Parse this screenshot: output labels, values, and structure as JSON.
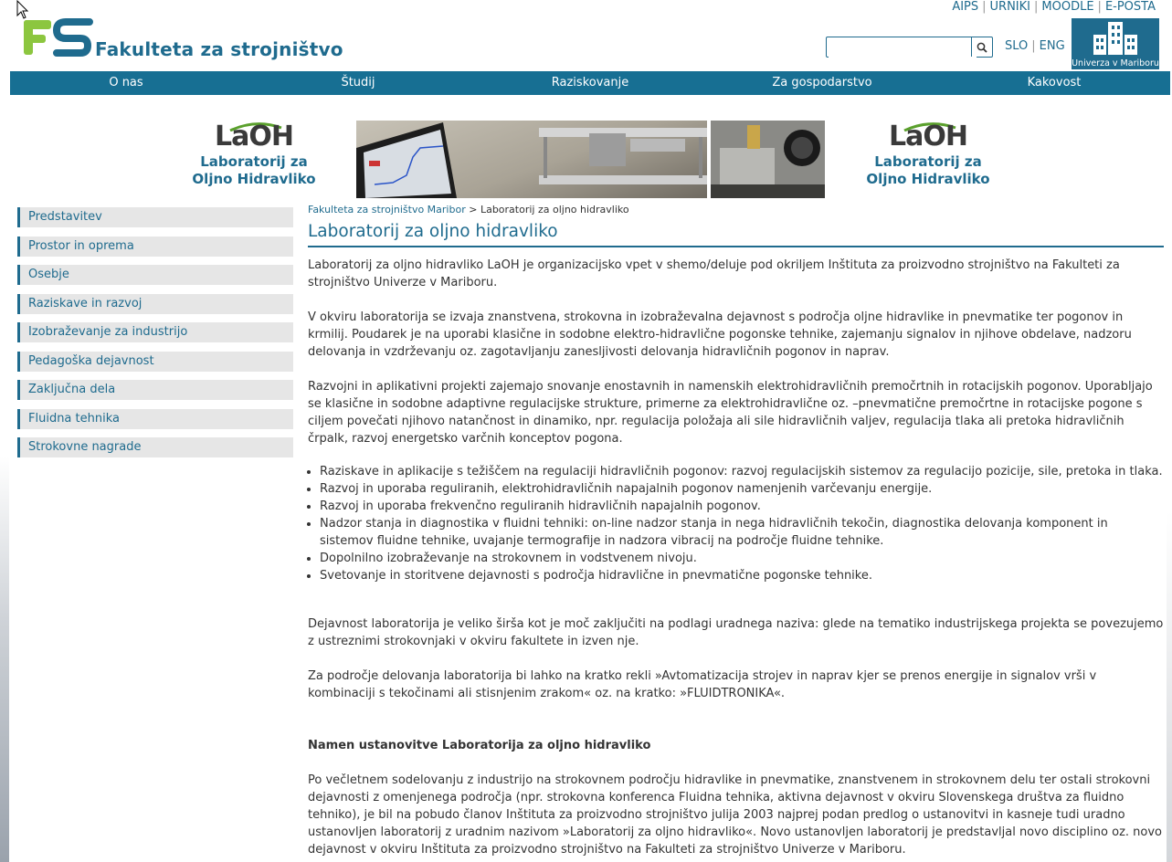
{
  "top_links": [
    "AIPS",
    "URNIKI",
    "MOODLE",
    "E-POŠTA"
  ],
  "logo": {
    "mark": "FS",
    "faculty": "Fakulteta za strojništvo"
  },
  "search": {
    "value": "",
    "placeholder": ""
  },
  "lang": [
    "SLO",
    "ENG"
  ],
  "university": {
    "caption": "Univerza v Mariboru"
  },
  "nav": [
    "O nas",
    "Študij",
    "Raziskovanje",
    "Za gospodarstvo",
    "Kakovost"
  ],
  "banner": {
    "lab_mark": "LaOH",
    "lab_line1": "Laboratorij za",
    "lab_line2": "Oljno Hidravliko"
  },
  "sidebar": [
    "Predstavitev",
    "Prostor in oprema",
    "Osebje",
    "Raziskave in razvoj",
    "Izobraževanje za industrijo",
    "Pedagoška dejavnost",
    "Zaključna dela",
    "Fluidna tehnika",
    "Strokovne nagrade"
  ],
  "breadcrumb": {
    "home": "Fakulteta za strojništvo Maribor",
    "separator": " > ",
    "current": "Laboratorij za oljno hidravliko"
  },
  "page_title": "Laboratorij za oljno hidravliko",
  "paragraphs": [
    "Laboratorij za oljno hidravliko LaOH je organizacijsko vpet v shemo/deluje pod okriljem Inštituta za proizvodno strojništvo na Fakulteti za strojništvo Univerze v Mariboru.",
    "V okviru laboratorija se izvaja znanstvena, strokovna in izobraževalna dejavnost s področja oljne hidravlike in pnevmatike ter pogonov in krmilij. Poudarek je na uporabi klasične in sodobne elektro-hidravlične pogonske tehnike, zajemanju signalov in njihove obdelave, nadzoru delovanja in vzdrževanju oz. zagotavljanju zanesljivosti delovanja hidravličnih pogonov in naprav.",
    "Razvojni in aplikativni projekti zajemajo snovanje enostavnih in namenskih elektrohidravličnih premočrtnih in rotacijskih pogonov. Uporabljajo se klasične in sodobne adaptivne regulacijske strukture, primerne za elektrohidravlične oz. –pnevmatične premočrtne in rotacijske pogone s ciljem povečati njihovo natančnost in dinamiko, npr. regulacija položaja ali sile hidravličnih valjev, regulacija tlaka ali pretoka hidravličnih črpalk, razvoj energetsko varčnih konceptov pogona."
  ],
  "bullets": [
    "Raziskave in aplikacije s težiščem na regulaciji hidravličnih pogonov: razvoj regulacijskih sistemov za regulacijo pozicije, sile, pretoka in tlaka.",
    "Razvoj in uporaba reguliranih, elektrohidravličnih napajalnih pogonov namenjenih varčevanju energije.",
    "Razvoj in uporaba frekvenčno reguliranih hidravličnih napajalnih pogonov.",
    "Nadzor stanja in diagnostika v fluidni tehniki: on-line nadzor stanja in nega hidravličnih tekočin, diagnostika delovanja komponent in sistemov fluidne tehnike, uvajanje termografije in nadzora vibracij na področje fluidne tehnike.",
    "Dopolnilno izobraževanje na strokovnem in vodstvenem nivoju.",
    "Svetovanje in storitvene dejavnosti s področja hidravlične in pnevmatične pogonske tehnike."
  ],
  "paragraphs2": [
    "Dejavnost laboratorija je veliko širša kot je moč zaključiti na podlagi uradnega naziva: glede na tematiko industrijskega projekta se povezujemo z ustreznimi strokovnjaki v okviru fakultete in izven nje.",
    "Za področje delovanja laboratorija bi lahko na kratko rekli »Avtomatizacija strojev in naprav kjer se prenos energije in signalov vrši v kombinaciji s tekočinami ali stisnjenim zrakom« oz. na kratko: »FLUIDTRONIKA«."
  ],
  "section_heading": "Namen ustanovitve Laboratorija za oljno hidravliko",
  "section_paragraph": "Po večletnem sodelovanju z industrijo na strokovnem področju hidravlike in pnevmatike, znanstvenem in strokovnem delu ter ostali strokovni dejavnosti z omenjenega področja (npr. strokovna konferenca Fluidna tehnika, aktivna dejavnost v okviru Slovenskega društva za fluidno tehniko), je bil na pobudo članov Inštituta za proizvodno strojništvo julija 2003 najprej podan predlog o ustanovitvi in kasneje tudi uradno ustanovljen laboratorij z uradnim nazivom »Laboratorij za oljno hidravliko«. Novo ustanovljen laboratorij je predstavljal novo disciplino oz. novo dejavnost v okviru Inštituta za proizvodno strojništvo na Fakulteti za strojništvo Univerze v Mariboru.",
  "colors": {
    "brand_blue": "#1f6b8e",
    "nav_blue": "#176f93",
    "fs_green": "#8cc63f",
    "fs_blue": "#1f6b8e"
  },
  "icons": [
    "mouse-cursor-icon",
    "search-icon",
    "university-building-icon"
  ]
}
